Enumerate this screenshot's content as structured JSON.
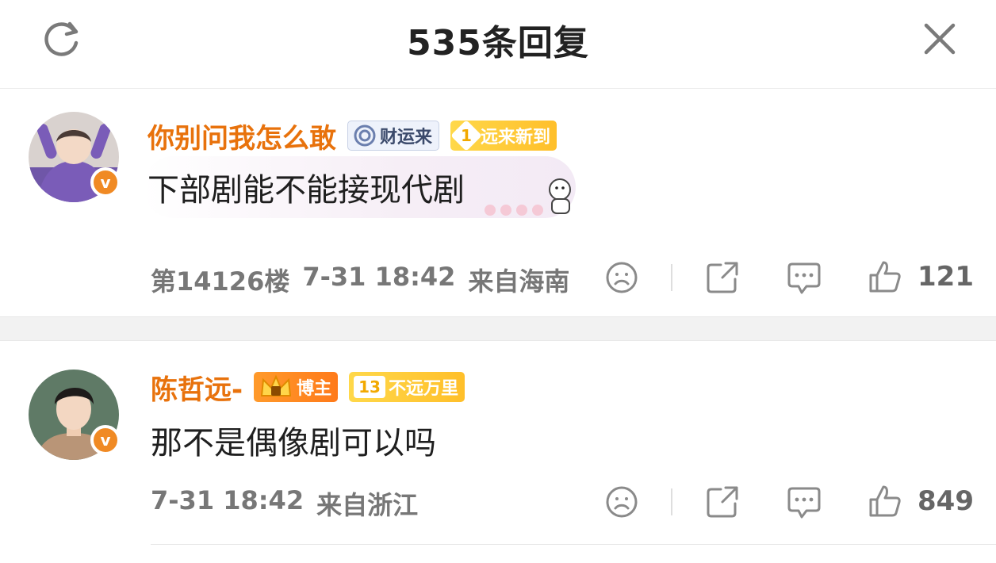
{
  "header": {
    "title": "535条回复"
  },
  "comments": [
    {
      "username": "你别问我怎么敢",
      "badges": [
        "财运来",
        "远来新到"
      ],
      "fan_level": "1",
      "text": "下部剧能不能接现代剧",
      "meta": {
        "floor": "第14126楼",
        "time": "7-31 18:42",
        "location": "来自海南"
      },
      "likes": "121"
    },
    {
      "username": "陈哲远-",
      "badges": [
        "博主",
        "不远万里"
      ],
      "fan_level": "13",
      "text": "那不是偶像剧可以吗",
      "meta": {
        "time": "7-31 18:42",
        "location": "来自浙江"
      },
      "likes": "849"
    }
  ],
  "colors": {
    "username": "#e8720c",
    "vbadge": "#f08a24",
    "separator": "#f2f2f2"
  },
  "icons": [
    "refresh-icon",
    "close-icon",
    "sad-face-icon",
    "share-icon",
    "comment-icon",
    "thumbs-up-icon"
  ]
}
